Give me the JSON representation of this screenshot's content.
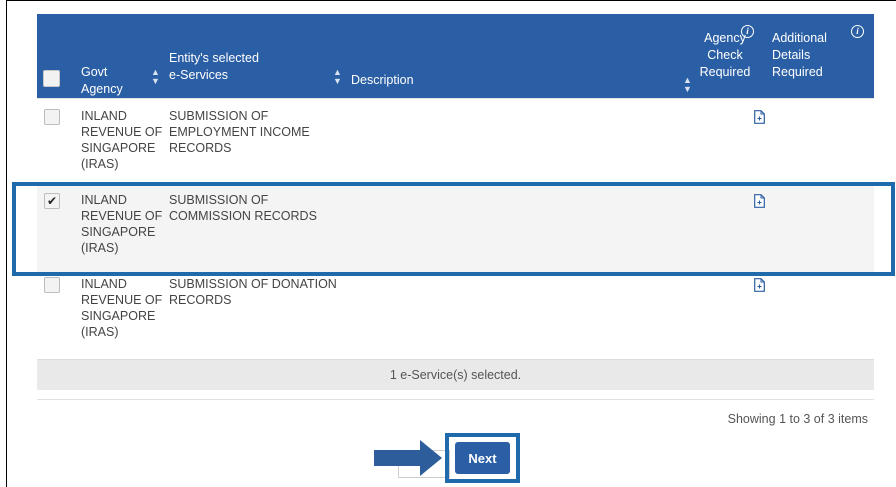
{
  "table": {
    "headers": {
      "agency": "Govt\nAgency",
      "services": "Entity's selected\ne-Services",
      "description": "Description",
      "check_required": "Agency\nCheck\nRequired",
      "details_required": "Additional\nDetails\nRequired"
    },
    "rows": [
      {
        "agency": "INLAND\nREVENUE OF\nSINGAPORE\n(IRAS)",
        "service": "SUBMISSION OF\nEMPLOYMENT INCOME\nRECORDS",
        "description": "",
        "selected": false
      },
      {
        "agency": "INLAND\nREVENUE OF\nSINGAPORE\n(IRAS)",
        "service": "SUBMISSION OF\nCOMMISSION RECORDS",
        "description": "",
        "selected": true
      },
      {
        "agency": "INLAND\nREVENUE OF\nSINGAPORE\n(IRAS)",
        "service": "SUBMISSION OF DONATION\nRECORDS",
        "description": "",
        "selected": false
      }
    ],
    "selected_summary": "1 e-Service(s) selected."
  },
  "paging": {
    "text": "Showing 1 to 3 of 3 items"
  },
  "actions": {
    "next_label": "Next"
  },
  "icons": {
    "header_info": "info-icon",
    "sort": "sort-icon",
    "row_action": "add-document-icon",
    "pointer": "arrow-right-icon"
  },
  "colors": {
    "header_bg": "#2b5fa5",
    "highlight": "#1e6aab",
    "selected_row_bg": "#f4f4f4"
  }
}
